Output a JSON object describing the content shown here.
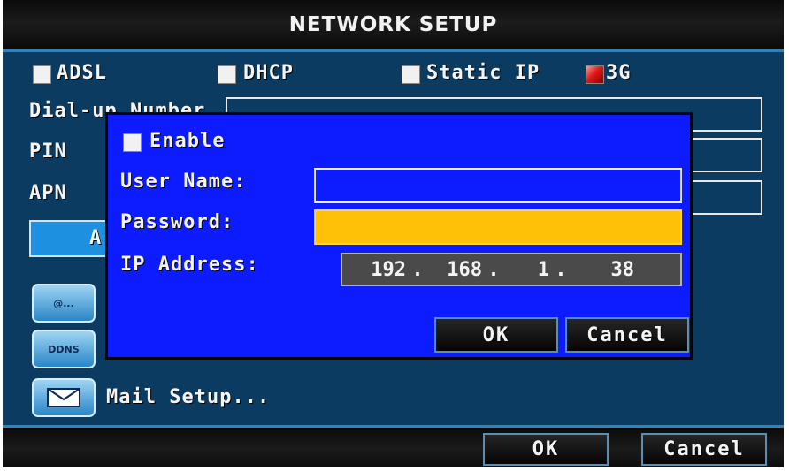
{
  "window": {
    "title": "NETWORK SETUP"
  },
  "modes": [
    {
      "label": "ADSL",
      "checked": false
    },
    {
      "label": "DHCP",
      "checked": false
    },
    {
      "label": "Static IP",
      "checked": false
    },
    {
      "label": "3G",
      "checked": true
    }
  ],
  "background_fields": {
    "dialup_label": "Dial-up Number",
    "pin_label": "PIN",
    "apn_label": "APN",
    "partial_button_label": "A"
  },
  "side_icons": [
    {
      "name": "email-icon",
      "label": "@..."
    },
    {
      "name": "ddns-icon",
      "label": "DDNS"
    },
    {
      "name": "mail-icon",
      "label": ""
    }
  ],
  "mail_setup_label": "Mail Setup...",
  "dialog": {
    "enable_label": "Enable",
    "enable_checked": false,
    "username_label": "User Name:",
    "username_value": "",
    "password_label": "Password:",
    "password_value": "",
    "ip_label": "IP Address:",
    "ip": [
      "192",
      "168",
      "1",
      "38"
    ],
    "ok_label": "OK",
    "cancel_label": "Cancel"
  },
  "footer": {
    "ok_label": "OK",
    "cancel_label": "Cancel"
  },
  "colors": {
    "background": "#0b3b60",
    "dialog": "#0d1bff",
    "accent": "#2e84b8",
    "password_field": "#ffc107",
    "checked": "#d01010"
  }
}
